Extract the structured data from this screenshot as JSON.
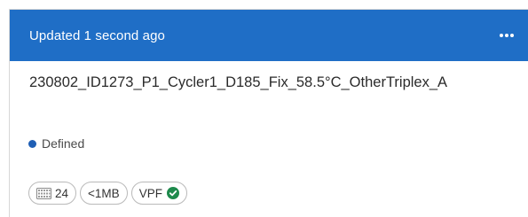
{
  "header": {
    "updated_text": "Updated 1 second ago",
    "more_icon": "ellipsis-icon",
    "background_color": "#1f6ec6"
  },
  "plate": {
    "name": "230802_ID1273_P1_Cycler1_D185_Fix_58.5°C_OtherTriplex_A"
  },
  "status": {
    "label": "Defined",
    "dot_color": "#1f5fb5"
  },
  "chips": {
    "wells": {
      "icon": "plate-grid-icon",
      "label": "24"
    },
    "size": {
      "label": "<1MB"
    },
    "vpf": {
      "label": "VPF",
      "icon": "check-circle-icon",
      "icon_color": "#1e8a4c"
    }
  }
}
